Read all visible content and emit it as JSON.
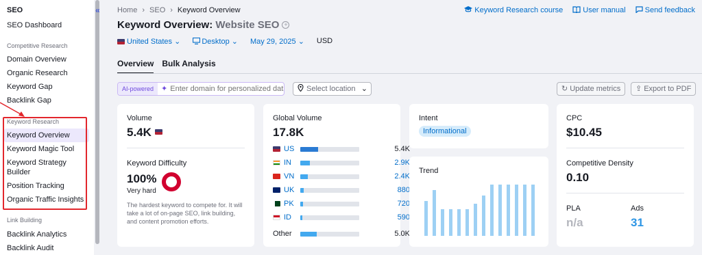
{
  "sidebar": {
    "title": "SEO",
    "dashboard": "SEO Dashboard",
    "sections": {
      "competitive": "Competitive Research",
      "keyword": "Keyword Research",
      "link": "Link Building"
    },
    "competitive_items": [
      "Domain Overview",
      "Organic Research",
      "Keyword Gap",
      "Backlink Gap"
    ],
    "keyword_items": [
      "Keyword Overview",
      "Keyword Magic Tool",
      "Keyword Strategy",
      "Builder",
      "Position Tracking",
      "Organic Traffic Insights"
    ],
    "link_items": [
      "Backlink Analytics",
      "Backlink Audit"
    ],
    "collapse_glyph": "«"
  },
  "breadcrumb": {
    "home": "Home",
    "seo": "SEO",
    "current": "Keyword Overview",
    "sep": "›"
  },
  "toplinks": {
    "course": "Keyword Research course",
    "manual": "User manual",
    "feedback": "Send feedback"
  },
  "title": {
    "prefix": "Keyword Overview:",
    "keyword": "Website SEO",
    "plus": "+"
  },
  "filters": {
    "country": "United States",
    "device": "Desktop",
    "date": "May 29, 2025",
    "currency": "USD",
    "chev": "⌄"
  },
  "tabs": [
    "Overview",
    "Bulk Analysis"
  ],
  "toolbar": {
    "ai_tag": "AI-powered",
    "ai_placeholder": "Enter domain for personalized data",
    "location_placeholder": "Select location",
    "update": "Update metrics",
    "export": "Export to PDF"
  },
  "volume": {
    "label": "Volume",
    "value": "5.4K"
  },
  "difficulty": {
    "label": "Keyword Difficulty",
    "value": "100%",
    "level": "Very hard",
    "percent": 100,
    "desc": [
      "The hardest keyword to compete for. It will",
      "take a lot of on-page SEO, link building,",
      "and content promotion efforts."
    ]
  },
  "global_volume": {
    "label": "Global Volume",
    "value": "17.8K",
    "rows": [
      {
        "code": "US",
        "flag": "f-us",
        "value": "5.4K",
        "share": 0.3,
        "color": "#2b7bd3",
        "link": false
      },
      {
        "code": "IN",
        "flag": "f-in",
        "value": "2.9K",
        "share": 0.16,
        "color": "#43a9ef",
        "link": true
      },
      {
        "code": "VN",
        "flag": "f-vn",
        "value": "2.4K",
        "share": 0.13,
        "color": "#43a9ef",
        "link": true
      },
      {
        "code": "UK",
        "flag": "f-uk",
        "value": "880",
        "share": 0.06,
        "color": "#43a9ef",
        "link": true
      },
      {
        "code": "PK",
        "flag": "f-pk",
        "value": "720",
        "share": 0.05,
        "color": "#43a9ef",
        "link": true
      },
      {
        "code": "ID",
        "flag": "f-id",
        "value": "590",
        "share": 0.04,
        "color": "#43a9ef",
        "link": true
      }
    ],
    "other_label": "Other",
    "other_value": "5.0K",
    "other_share": 0.28
  },
  "intent": {
    "label": "Intent",
    "value": "Informational"
  },
  "trend": {
    "label": "Trend",
    "values": [
      0.65,
      0.86,
      0.5,
      0.5,
      0.5,
      0.5,
      0.6,
      0.76,
      0.96,
      0.96,
      0.96,
      0.96,
      0.96,
      0.96
    ]
  },
  "cpc": {
    "label": "CPC",
    "value": "$10.45"
  },
  "density": {
    "label": "Competitive Density",
    "value": "0.10"
  },
  "pla": {
    "label": "PLA",
    "value": "n/a"
  },
  "ads": {
    "label": "Ads",
    "value": "31"
  },
  "colors": {
    "accent": "#006dca",
    "red": "#d1002f",
    "highlight": "#e2262c"
  }
}
